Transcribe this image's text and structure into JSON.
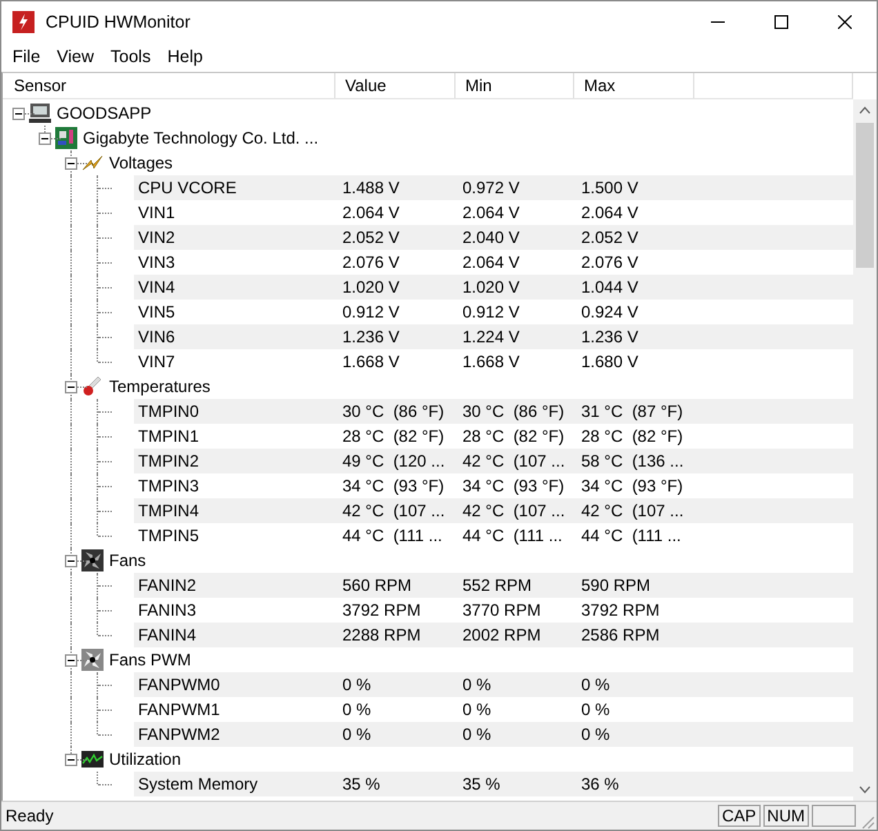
{
  "window": {
    "title": "CPUID HWMonitor"
  },
  "menu": [
    "File",
    "View",
    "Tools",
    "Help"
  ],
  "columns": [
    "Sensor",
    "Value",
    "Min",
    "Max"
  ],
  "tree": [
    {
      "name": "GOODSAPP",
      "kind": "computer",
      "expanded": true,
      "children": [
        {
          "name": "Gigabyte Technology Co. Ltd. ...",
          "kind": "motherboard",
          "expanded": true,
          "children": [
            {
              "name": "Voltages",
              "kind": "voltage",
              "expanded": true,
              "children": [
                {
                  "name": "CPU VCORE",
                  "value": "1.488 V",
                  "min": "0.972 V",
                  "max": "1.500 V"
                },
                {
                  "name": "VIN1",
                  "value": "2.064 V",
                  "min": "2.064 V",
                  "max": "2.064 V"
                },
                {
                  "name": "VIN2",
                  "value": "2.052 V",
                  "min": "2.040 V",
                  "max": "2.052 V"
                },
                {
                  "name": "VIN3",
                  "value": "2.076 V",
                  "min": "2.064 V",
                  "max": "2.076 V"
                },
                {
                  "name": "VIN4",
                  "value": "1.020 V",
                  "min": "1.020 V",
                  "max": "1.044 V"
                },
                {
                  "name": "VIN5",
                  "value": "0.912 V",
                  "min": "0.912 V",
                  "max": "0.924 V"
                },
                {
                  "name": "VIN6",
                  "value": "1.236 V",
                  "min": "1.224 V",
                  "max": "1.236 V"
                },
                {
                  "name": "VIN7",
                  "value": "1.668 V",
                  "min": "1.668 V",
                  "max": "1.680 V"
                }
              ]
            },
            {
              "name": "Temperatures",
              "kind": "temperature",
              "expanded": true,
              "children": [
                {
                  "name": "TMPIN0",
                  "value": "30 °C  (86 °F)",
                  "min": "30 °C  (86 °F)",
                  "max": "31 °C  (87 °F)"
                },
                {
                  "name": "TMPIN1",
                  "value": "28 °C  (82 °F)",
                  "min": "28 °C  (82 °F)",
                  "max": "28 °C  (82 °F)"
                },
                {
                  "name": "TMPIN2",
                  "value": "49 °C  (120 ...",
                  "min": "42 °C  (107 ...",
                  "max": "58 °C  (136 ..."
                },
                {
                  "name": "TMPIN3",
                  "value": "34 °C  (93 °F)",
                  "min": "34 °C  (93 °F)",
                  "max": "34 °C  (93 °F)"
                },
                {
                  "name": "TMPIN4",
                  "value": "42 °C  (107 ...",
                  "min": "42 °C  (107 ...",
                  "max": "42 °C  (107 ..."
                },
                {
                  "name": "TMPIN5",
                  "value": "44 °C  (111 ...",
                  "min": "44 °C  (111 ...",
                  "max": "44 °C  (111 ..."
                }
              ]
            },
            {
              "name": "Fans",
              "kind": "fan",
              "expanded": true,
              "children": [
                {
                  "name": "FANIN2",
                  "value": "560 RPM",
                  "min": "552 RPM",
                  "max": "590 RPM"
                },
                {
                  "name": "FANIN3",
                  "value": "3792 RPM",
                  "min": "3770 RPM",
                  "max": "3792 RPM"
                },
                {
                  "name": "FANIN4",
                  "value": "2288 RPM",
                  "min": "2002 RPM",
                  "max": "2586 RPM"
                }
              ]
            },
            {
              "name": "Fans PWM",
              "kind": "fan-pwm",
              "expanded": true,
              "children": [
                {
                  "name": "FANPWM0",
                  "value": "0 %",
                  "min": "0 %",
                  "max": "0 %"
                },
                {
                  "name": "FANPWM1",
                  "value": "0 %",
                  "min": "0 %",
                  "max": "0 %"
                },
                {
                  "name": "FANPWM2",
                  "value": "0 %",
                  "min": "0 %",
                  "max": "0 %"
                }
              ]
            },
            {
              "name": "Utilization",
              "kind": "utilization",
              "expanded": true,
              "children": [
                {
                  "name": "System Memory",
                  "value": "35 %",
                  "min": "35 %",
                  "max": "36 %"
                }
              ]
            }
          ]
        }
      ]
    }
  ],
  "status_bar": {
    "text": "Ready",
    "indicators": [
      "CAP",
      "NUM"
    ]
  }
}
